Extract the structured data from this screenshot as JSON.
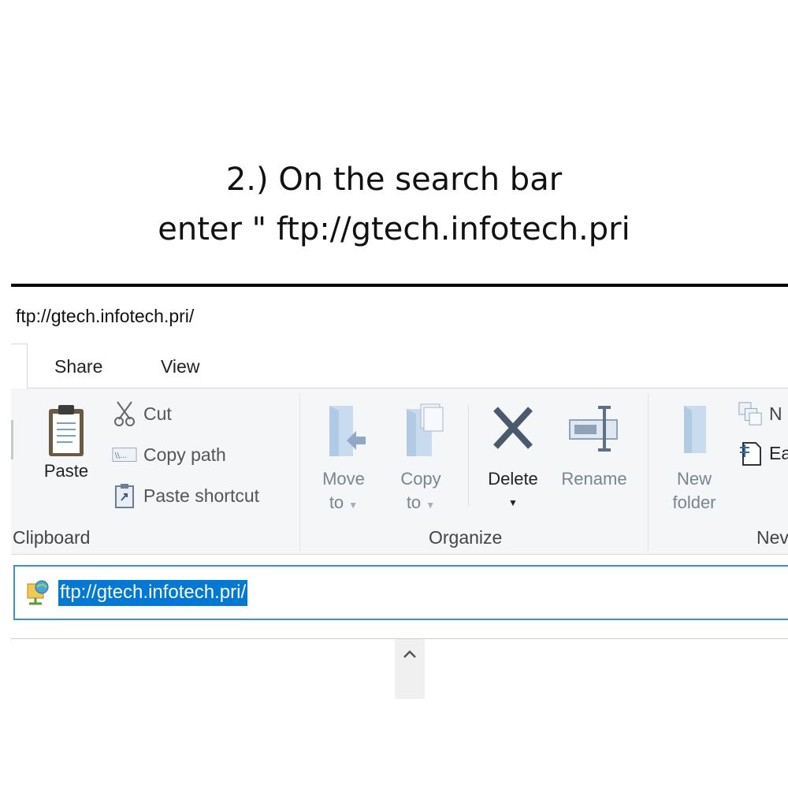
{
  "instruction": {
    "line1": "2.) On the search bar",
    "line2": "enter \" ftp://gtech.infotech.pri"
  },
  "window": {
    "title": "ftp://gtech.infotech.pri/"
  },
  "tabs": [
    {
      "label": "Share"
    },
    {
      "label": "View"
    }
  ],
  "ribbon": {
    "clipboard": {
      "label": "Clipboard",
      "paste": "Paste",
      "cut": "Cut",
      "copy_path": "Copy path",
      "paste_shortcut": "Paste shortcut"
    },
    "organize": {
      "label": "Organize",
      "move_to_line1": "Move",
      "move_to_line2": "to",
      "copy_to_line1": "Copy",
      "copy_to_line2": "to",
      "delete": "Delete",
      "rename": "Rename"
    },
    "new": {
      "label": "Nev",
      "new_folder_line1": "New",
      "new_folder_line2": "folder",
      "new_item": "N",
      "easy_access": "Ea"
    }
  },
  "address_bar": {
    "value": "ftp://gtech.infotech.pri/"
  },
  "colors": {
    "selection": "#0078d7",
    "address_border": "#3a8ee6",
    "ribbon_bg": "#f5f6f7"
  }
}
